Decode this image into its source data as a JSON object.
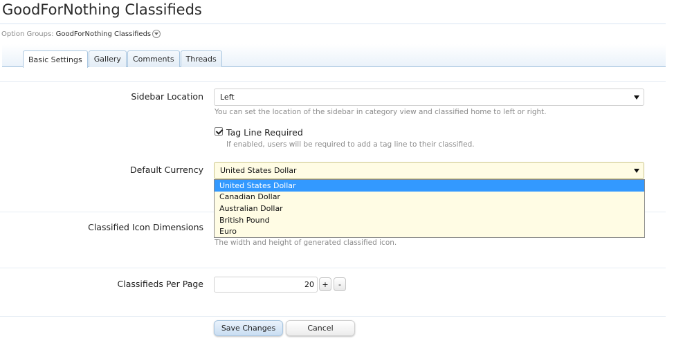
{
  "page": {
    "title": "GoodForNothing Classifieds",
    "breadcrumb_label": "Option Groups:",
    "breadcrumb_value": "GoodForNothing Classifieds"
  },
  "tabs": [
    {
      "label": "Basic Settings",
      "active": true
    },
    {
      "label": "Gallery"
    },
    {
      "label": "Comments"
    },
    {
      "label": "Threads"
    }
  ],
  "settings": {
    "sidebar": {
      "label": "Sidebar Location",
      "value": "Left",
      "hint": "You can set the location of the sidebar in category view and classified home to left or right."
    },
    "tagline": {
      "label": "Tag Line Required",
      "checked": true,
      "hint": "If enabled, users will be required to add a tag line to their classified."
    },
    "currency": {
      "label": "Default Currency",
      "value": "United States Dollar",
      "options": [
        "United States Dollar",
        "Canadian Dollar",
        "Australian Dollar",
        "British Pound",
        "Euro"
      ]
    },
    "icon_dimensions": {
      "label": "Classified Icon Dimensions",
      "hint": "The width and height of generated classified icon."
    },
    "per_page": {
      "label": "Classifieds Per Page",
      "value": "20",
      "plus": "+",
      "minus": "-"
    }
  },
  "buttons": {
    "save": "Save Changes",
    "cancel": "Cancel"
  }
}
